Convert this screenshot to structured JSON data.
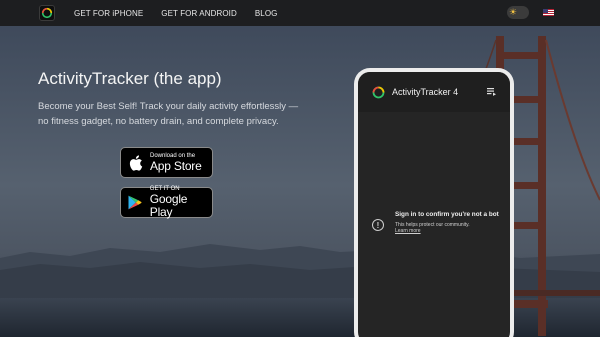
{
  "nav": {
    "links": [
      "GET FOR iPHONE",
      "GET FOR ANDROID",
      "BLOG"
    ],
    "theme_icon": "sun-icon",
    "language_flag": "us-flag"
  },
  "hero": {
    "title": "ActivityTracker (the app)",
    "subtitle": "Become your Best Self! Track your daily activity effortlessly — no fitness gadget, no battery drain, and complete privacy."
  },
  "app_store": {
    "small": "Download on the",
    "big": "App Store"
  },
  "google_play": {
    "small": "GET IT ON",
    "big": "Google Play"
  },
  "phone": {
    "app_title": "ActivityTracker 4",
    "captcha_title": "Sign in to confirm you're not a bot",
    "captcha_sub": "This helps protect our community.",
    "captcha_link": "Learn more"
  },
  "colors": {
    "nav_bg": "#1d1e20",
    "phone_frame": "#ececec",
    "phone_screen": "#252525",
    "ring_accent": "#f2c200",
    "ring_secondary": "#30c46a"
  }
}
